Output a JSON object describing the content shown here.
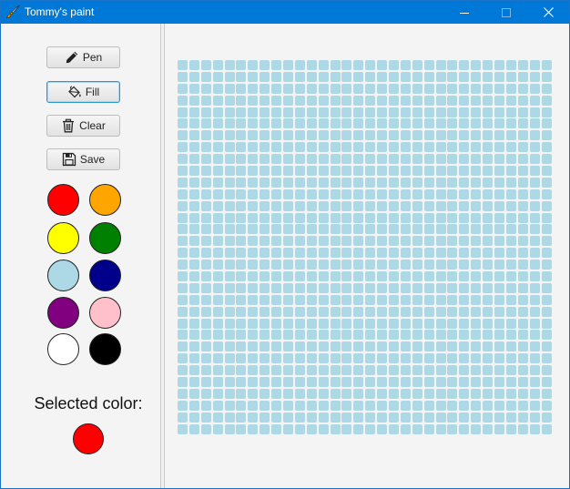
{
  "window": {
    "title": "Tommy's paint"
  },
  "tools": [
    {
      "label": "Pen",
      "icon": "pencil-icon",
      "active": false
    },
    {
      "label": "Fill",
      "icon": "paint-bucket-icon",
      "active": true
    },
    {
      "label": "Clear",
      "icon": "trash-icon",
      "active": false
    },
    {
      "label": "Save",
      "icon": "floppy-disk-icon",
      "active": false
    }
  ],
  "palette": [
    {
      "name": "red",
      "hex": "#ff0000"
    },
    {
      "name": "orange",
      "hex": "#ffa500"
    },
    {
      "name": "yellow",
      "hex": "#ffff00"
    },
    {
      "name": "green",
      "hex": "#008000"
    },
    {
      "name": "lightblue",
      "hex": "#add8e6"
    },
    {
      "name": "darkblue",
      "hex": "#00008b"
    },
    {
      "name": "purple",
      "hex": "#800080"
    },
    {
      "name": "pink",
      "hex": "#ffc0cb"
    },
    {
      "name": "white",
      "hex": "#ffffff"
    },
    {
      "name": "black",
      "hex": "#000000"
    }
  ],
  "selected": {
    "label": "Selected color:",
    "hex": "#ff0000"
  },
  "canvas": {
    "rows": 32,
    "cols": 32,
    "fill_color": "#add8e6"
  }
}
